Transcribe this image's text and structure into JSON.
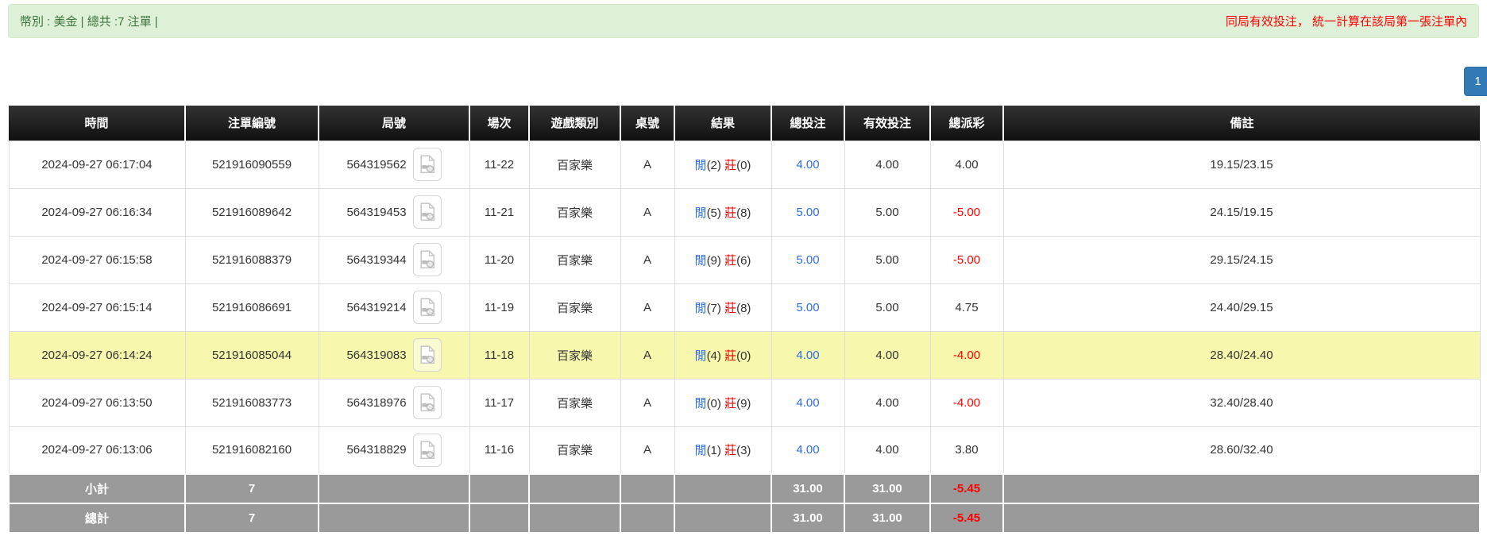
{
  "top_bar": {
    "left_text": "幣別 : 美金 | 總共 :7 注單 |",
    "right_text": "同局有效投注， 統一計算在該局第一張注單內"
  },
  "pagination": {
    "page": "1"
  },
  "icons": {
    "video_replay": "video-file-glyph"
  },
  "colors": {
    "summary_bg": "#dff0d8",
    "summary_text": "#3c763d",
    "note_red": "#ff0000",
    "header_bg": "#1a1a1a",
    "footer_bg": "#9a9a9a",
    "highlight_row": "#f7f7ad",
    "link_blue": "#2e6ce6",
    "banker_red": "#e80000",
    "negative_red": "#ff0000",
    "pagination_blue": "#337ab7"
  },
  "table": {
    "headers": [
      "時間",
      "注單編號",
      "局號",
      "場次",
      "遊戲類別",
      "桌號",
      "結果",
      "總投注",
      "有效投注",
      "總派彩",
      "備註"
    ],
    "rows": [
      {
        "time": "2024-09-27 06:17:04",
        "bet_id": "521916090559",
        "round_id": "564319562",
        "session": "11-22",
        "game_type": "百家樂",
        "table_no": "A",
        "result": {
          "player_label": "閒",
          "player_score": "(2)",
          "banker_label": "莊",
          "banker_score": "(0)"
        },
        "total_bet": "4.00",
        "valid_bet": "4.00",
        "payout": "4.00",
        "remark": "19.15/23.15",
        "highlight": false
      },
      {
        "time": "2024-09-27 06:16:34",
        "bet_id": "521916089642",
        "round_id": "564319453",
        "session": "11-21",
        "game_type": "百家樂",
        "table_no": "A",
        "result": {
          "player_label": "閒",
          "player_score": "(5)",
          "banker_label": "莊",
          "banker_score": "(8)"
        },
        "total_bet": "5.00",
        "valid_bet": "5.00",
        "payout": "-5.00",
        "remark": "24.15/19.15",
        "highlight": false
      },
      {
        "time": "2024-09-27 06:15:58",
        "bet_id": "521916088379",
        "round_id": "564319344",
        "session": "11-20",
        "game_type": "百家樂",
        "table_no": "A",
        "result": {
          "player_label": "閒",
          "player_score": "(9)",
          "banker_label": "莊",
          "banker_score": "(6)"
        },
        "total_bet": "5.00",
        "valid_bet": "5.00",
        "payout": "-5.00",
        "remark": "29.15/24.15",
        "highlight": false
      },
      {
        "time": "2024-09-27 06:15:14",
        "bet_id": "521916086691",
        "round_id": "564319214",
        "session": "11-19",
        "game_type": "百家樂",
        "table_no": "A",
        "result": {
          "player_label": "閒",
          "player_score": "(7)",
          "banker_label": "莊",
          "banker_score": "(8)"
        },
        "total_bet": "5.00",
        "valid_bet": "5.00",
        "payout": "4.75",
        "remark": "24.40/29.15",
        "highlight": false
      },
      {
        "time": "2024-09-27 06:14:24",
        "bet_id": "521916085044",
        "round_id": "564319083",
        "session": "11-18",
        "game_type": "百家樂",
        "table_no": "A",
        "result": {
          "player_label": "閒",
          "player_score": "(4)",
          "banker_label": "莊",
          "banker_score": "(0)"
        },
        "total_bet": "4.00",
        "valid_bet": "4.00",
        "payout": "-4.00",
        "remark": "28.40/24.40",
        "highlight": true
      },
      {
        "time": "2024-09-27 06:13:50",
        "bet_id": "521916083773",
        "round_id": "564318976",
        "session": "11-17",
        "game_type": "百家樂",
        "table_no": "A",
        "result": {
          "player_label": "閒",
          "player_score": "(0)",
          "banker_label": "莊",
          "banker_score": "(9)"
        },
        "total_bet": "4.00",
        "valid_bet": "4.00",
        "payout": "-4.00",
        "remark": "32.40/28.40",
        "highlight": false
      },
      {
        "time": "2024-09-27 06:13:06",
        "bet_id": "521916082160",
        "round_id": "564318829",
        "session": "11-16",
        "game_type": "百家樂",
        "table_no": "A",
        "result": {
          "player_label": "閒",
          "player_score": "(1)",
          "banker_label": "莊",
          "banker_score": "(3)"
        },
        "total_bet": "4.00",
        "valid_bet": "4.00",
        "payout": "3.80",
        "remark": "28.60/32.40",
        "highlight": false
      }
    ],
    "subtotal": {
      "label": "小計",
      "count": "7",
      "total_bet": "31.00",
      "valid_bet": "31.00",
      "payout": "-5.45"
    },
    "total": {
      "label": "總計",
      "count": "7",
      "total_bet": "31.00",
      "valid_bet": "31.00",
      "payout": "-5.45"
    }
  }
}
